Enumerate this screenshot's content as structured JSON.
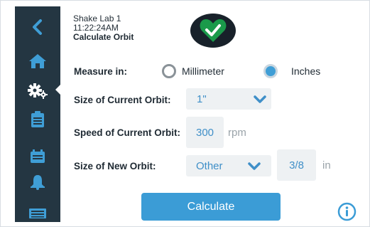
{
  "header": {
    "lab_name": "Shake Lab 1",
    "time": "11:22:24AM",
    "screen_title": "Calculate Orbit",
    "status_icon": "heart-check-icon",
    "status_color": "#1a9a4a"
  },
  "sidebar": {
    "items": [
      {
        "name": "back",
        "icon": "chevron-left-icon"
      },
      {
        "name": "home",
        "icon": "home-icon"
      },
      {
        "name": "settings",
        "icon": "gears-icon",
        "active": true
      },
      {
        "name": "notes",
        "icon": "clipboard-icon"
      },
      {
        "name": "calendar",
        "icon": "calendar-icon"
      },
      {
        "name": "alerts",
        "icon": "bell-icon"
      },
      {
        "name": "device",
        "icon": "device-icon"
      }
    ],
    "icon_color": "#3f9ed6",
    "active_icon_color": "#ffffff",
    "background": "#243642"
  },
  "form": {
    "measure_label": "Measure in:",
    "measure_options": [
      {
        "label": "Millimeter",
        "selected": false
      },
      {
        "label": "Inches",
        "selected": true
      }
    ],
    "current_orbit_label": "Size of Current Orbit:",
    "current_orbit_value": "1\"",
    "speed_label": "Speed of Current Orbit:",
    "speed_value": "300",
    "speed_unit": "rpm",
    "new_orbit_label": "Size of New Orbit:",
    "new_orbit_value": "Other",
    "new_orbit_custom": "3/8",
    "new_orbit_unit": "in"
  },
  "actions": {
    "calculate_label": "Calculate",
    "info_icon": "info-icon",
    "accent": "#3b9cd6"
  }
}
